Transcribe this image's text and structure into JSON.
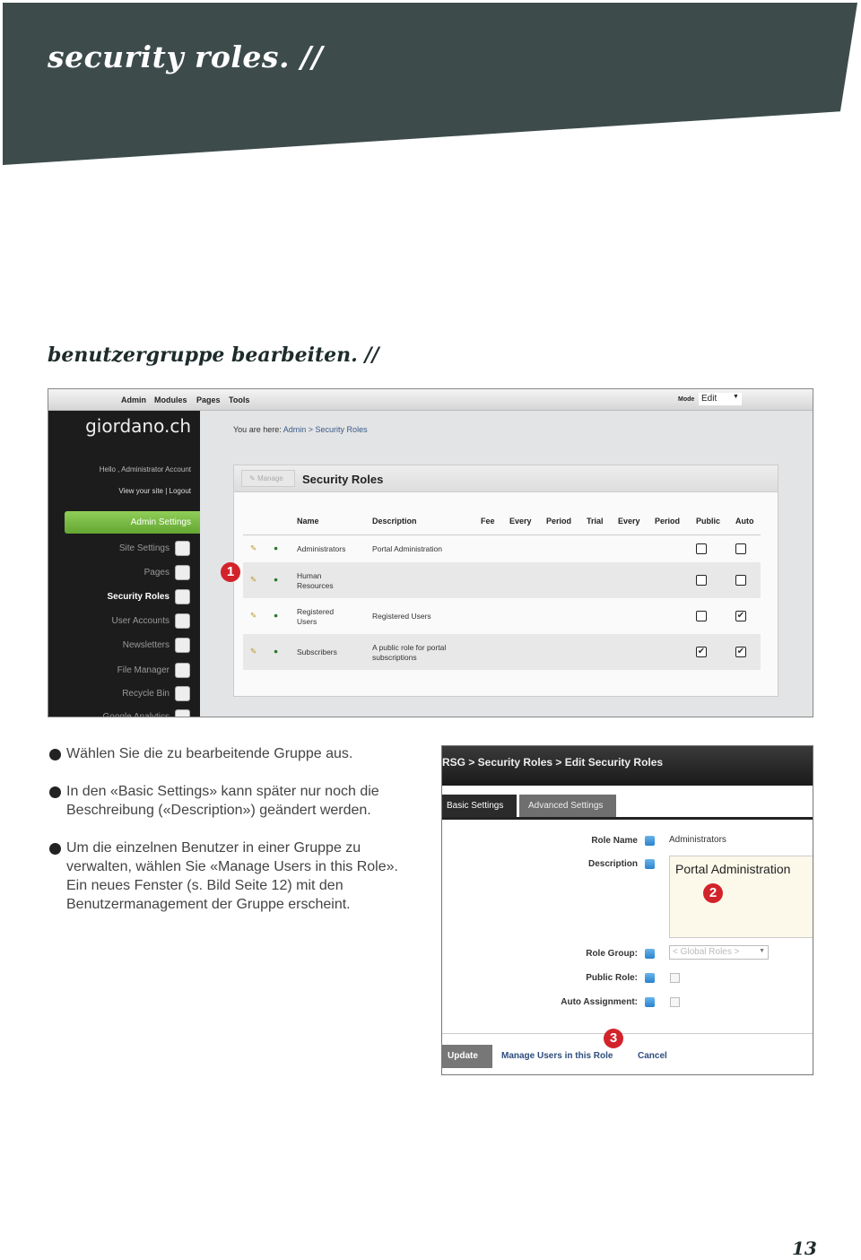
{
  "header": {
    "title": "security roles. //",
    "subtitle": "benutzergruppe bearbeiten. //",
    "banner_color": "#3d4b4b"
  },
  "screenshot1": {
    "menu": [
      "Admin",
      "Modules",
      "Pages",
      "Tools"
    ],
    "mode_label": "Mode",
    "mode_value": "Edit",
    "logo": "giordano.ch",
    "hello": "Hello , Administrator Account",
    "links": "View your site | Logout",
    "admin_settings": "Admin Settings",
    "sidebar": [
      {
        "label": "Site Settings",
        "icon": "site-settings-icon"
      },
      {
        "label": "Pages",
        "icon": "page-icon"
      },
      {
        "label": "Security Roles",
        "icon": "security-roles-icon",
        "active": true
      },
      {
        "label": "User Accounts",
        "icon": "user-accounts-icon"
      },
      {
        "label": "Newsletters",
        "icon": "newsletter-icon"
      },
      {
        "label": "File Manager",
        "icon": "folder-icon"
      },
      {
        "label": "Recycle Bin",
        "icon": "trash-icon"
      },
      {
        "label": "Google Analytics",
        "icon": "google-analytics-icon"
      }
    ],
    "breadcrumb": {
      "prefix": "You are here:",
      "root": "Admin",
      "sep": ">",
      "current": "Security Roles"
    },
    "manage_label": "Manage",
    "panel_title": "Security Roles",
    "columns": [
      "Name",
      "Description",
      "Fee",
      "Every",
      "Period",
      "Trial",
      "Every",
      "Period",
      "Public",
      "Auto"
    ],
    "rows": [
      {
        "name": "Administrators",
        "description": "Portal Administration",
        "public": false,
        "auto": false
      },
      {
        "name": "Human Resources",
        "description": "",
        "public": false,
        "auto": false
      },
      {
        "name": "Registered Users",
        "description": "Registered Users",
        "public": false,
        "auto": true
      },
      {
        "name": "Subscribers",
        "description": "A public role for portal subscriptions",
        "public": true,
        "auto": true
      }
    ],
    "marker": "1"
  },
  "notes": [
    {
      "num": "1",
      "text": "Wählen Sie die zu bearbeitende Gruppe aus."
    },
    {
      "num": "2",
      "text": "In den «Basic Settings» kann später nur noch die Beschreibung («Description») geändert werden."
    },
    {
      "num": "3",
      "text": "Um die einzelnen Benutzer in einer Gruppe zu verwalten, wählen Sie «Manage Users in this Role». Ein neues Fenster (s. Bild Seite 12) mit den Benutzermanagement der Gruppe erscheint."
    }
  ],
  "screenshot2": {
    "breadcrumb": "RSG > Security Roles > Edit Security Roles",
    "tabs": [
      "Basic Settings",
      "Advanced Settings"
    ],
    "role_name_label": "Role Name",
    "role_name": "Administrators",
    "description_label": "Description",
    "description": "Portal Administration",
    "role_group_label": "Role Group:",
    "role_group": "< Global Roles >",
    "public_role_label": "Public Role:",
    "public_role": false,
    "auto_assignment_label": "Auto Assignment:",
    "auto_assignment": false,
    "update": "Update",
    "manage_users": "Manage Users in this Role",
    "cancel": "Cancel",
    "marker2": "2",
    "marker3": "3"
  },
  "page_number": "13",
  "accent": "#d2232a"
}
